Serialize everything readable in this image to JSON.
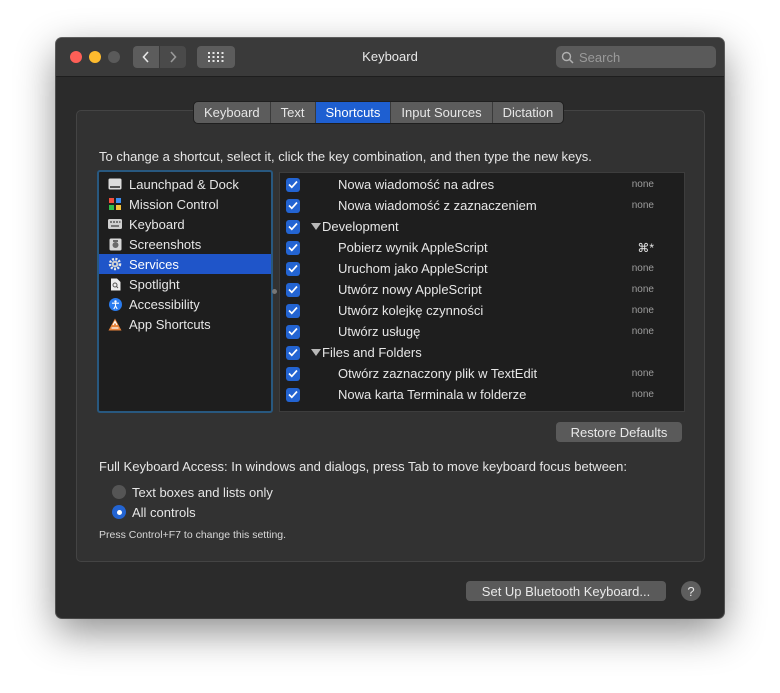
{
  "window": {
    "title": "Keyboard"
  },
  "search": {
    "placeholder": "Search"
  },
  "tabs": [
    {
      "label": "Keyboard"
    },
    {
      "label": "Text"
    },
    {
      "label": "Shortcuts",
      "active": true
    },
    {
      "label": "Input Sources"
    },
    {
      "label": "Dictation"
    }
  ],
  "instruction": "To change a shortcut, select it, click the key combination, and then type the new keys.",
  "categories": [
    {
      "label": "Launchpad & Dock",
      "icon": "launchpad-icon"
    },
    {
      "label": "Mission Control",
      "icon": "mission-control-icon"
    },
    {
      "label": "Keyboard",
      "icon": "keyboard-icon"
    },
    {
      "label": "Screenshots",
      "icon": "screenshot-icon"
    },
    {
      "label": "Services",
      "icon": "gear-icon",
      "selected": true
    },
    {
      "label": "Spotlight",
      "icon": "spotlight-icon"
    },
    {
      "label": "Accessibility",
      "icon": "accessibility-icon"
    },
    {
      "label": "App Shortcuts",
      "icon": "app-shortcuts-icon"
    }
  ],
  "shortcuts": [
    {
      "label": "Nowa wiadomość na adres",
      "key": "none",
      "checked": true,
      "group": false
    },
    {
      "label": "Nowa wiadomość z zaznaczeniem",
      "key": "none",
      "checked": true,
      "group": false
    },
    {
      "label": "Development",
      "key": "",
      "checked": true,
      "group": true
    },
    {
      "label": "Pobierz wynik AppleScript",
      "key": "⌘*",
      "checked": true,
      "group": false
    },
    {
      "label": "Uruchom jako AppleScript",
      "key": "none",
      "checked": true,
      "group": false
    },
    {
      "label": "Utwórz nowy AppleScript",
      "key": "none",
      "checked": true,
      "group": false
    },
    {
      "label": "Utwórz kolejkę czynności",
      "key": "none",
      "checked": true,
      "group": false
    },
    {
      "label": "Utwórz usługę",
      "key": "none",
      "checked": true,
      "group": false
    },
    {
      "label": "Files and Folders",
      "key": "",
      "checked": true,
      "group": true
    },
    {
      "label": "Otwórz zaznaczony plik w TextEdit",
      "key": "none",
      "checked": true,
      "group": false
    },
    {
      "label": "Nowa karta Terminala w folderze",
      "key": "none",
      "checked": true,
      "group": false
    }
  ],
  "restore_label": "Restore Defaults",
  "full_keyboard_access": {
    "label": "Full Keyboard Access: In windows and dialogs, press Tab to move keyboard focus between:",
    "options": [
      {
        "label": "Text boxes and lists only",
        "selected": false
      },
      {
        "label": "All controls",
        "selected": true
      }
    ],
    "hint": "Press Control+F7 to change this setting."
  },
  "bluetooth_button": "Set Up Bluetooth Keyboard...",
  "help_label": "?",
  "colors": {
    "accent": "#2364d2",
    "selection": "#1f55c9"
  }
}
